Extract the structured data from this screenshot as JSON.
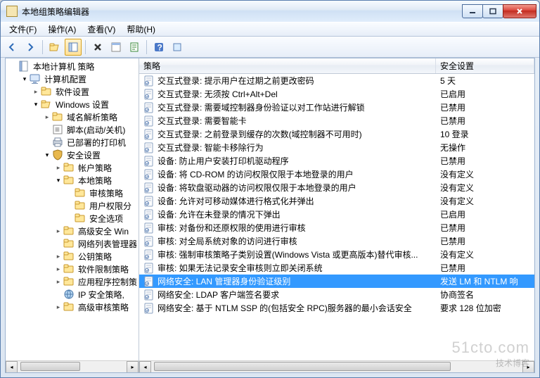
{
  "window": {
    "title": "本地组策略编辑器"
  },
  "menubar": {
    "file": "文件(F)",
    "action": "操作(A)",
    "view": "查看(V)",
    "help": "帮助(H)"
  },
  "tree": {
    "root": "本地计算机 策略",
    "computer_config": "计算机配置",
    "software_settings": "软件设置",
    "windows_settings": "Windows 设置",
    "dns_policy": "域名解析策略",
    "scripts": "脚本(启动/关机)",
    "deployed_printers": "已部署的打印机",
    "security_settings": "安全设置",
    "account_policies": "帐户策略",
    "local_policies": "本地策略",
    "audit_policy": "审核策略",
    "user_rights": "用户权限分",
    "security_options": "安全选项",
    "advanced_win": "高级安全 Win",
    "network_list": "网络列表管理器",
    "public_key": "公钥策略",
    "software_restriction": "软件限制策略",
    "app_control": "应用程序控制策",
    "ip_security": "IP 安全策略,",
    "advanced_audit": "高级审核策略"
  },
  "columns": {
    "policy": "策略",
    "setting": "安全设置"
  },
  "rows": [
    {
      "p": "交互式登录: 提示用户在过期之前更改密码",
      "s": "5 天"
    },
    {
      "p": "交互式登录: 无须按 Ctrl+Alt+Del",
      "s": "已启用"
    },
    {
      "p": "交互式登录: 需要域控制器身份验证以对工作站进行解锁",
      "s": "已禁用"
    },
    {
      "p": "交互式登录: 需要智能卡",
      "s": "已禁用"
    },
    {
      "p": "交互式登录: 之前登录到缓存的次数(域控制器不可用时)",
      "s": "10 登录"
    },
    {
      "p": "交互式登录: 智能卡移除行为",
      "s": "无操作"
    },
    {
      "p": "设备: 防止用户安装打印机驱动程序",
      "s": "已禁用"
    },
    {
      "p": "设备: 将 CD-ROM 的访问权限仅限于本地登录的用户",
      "s": "没有定义"
    },
    {
      "p": "设备: 将软盘驱动器的访问权限仅限于本地登录的用户",
      "s": "没有定义"
    },
    {
      "p": "设备: 允许对可移动媒体进行格式化并弹出",
      "s": "没有定义"
    },
    {
      "p": "设备: 允许在未登录的情况下弹出",
      "s": "已启用"
    },
    {
      "p": "审核: 对备份和还原权限的使用进行审核",
      "s": "已禁用"
    },
    {
      "p": "审核: 对全局系统对象的访问进行审核",
      "s": "已禁用"
    },
    {
      "p": "审核: 强制审核策略子类别设置(Windows Vista 或更高版本)替代审核...",
      "s": "没有定义"
    },
    {
      "p": "审核: 如果无法记录安全审核则立即关闭系统",
      "s": "已禁用"
    },
    {
      "p": "网络安全: LAN 管理器身份验证级别",
      "s": "发送 LM 和 NTLM 响",
      "selected": true
    },
    {
      "p": "网络安全: LDAP 客户端签名要求",
      "s": "协商签名"
    },
    {
      "p": "网络安全: 基于 NTLM SSP 的(包括安全 RPC)服务器的最小会话安全",
      "s": "要求 128 位加密"
    }
  ],
  "watermark": {
    "line1": "51cto.com",
    "line2": "技术博客"
  }
}
